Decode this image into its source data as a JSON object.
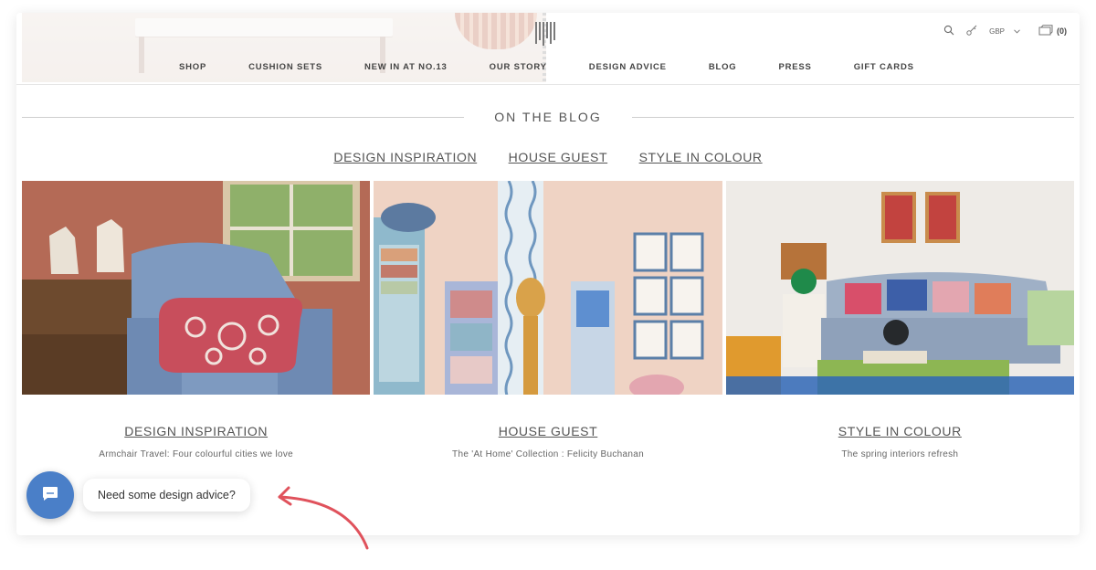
{
  "nav": {
    "items": [
      "SHOP",
      "CUSHION SETS",
      "NEW IN AT NO.13",
      "OUR STORY",
      "DESIGN ADVICE",
      "BLOG",
      "PRESS",
      "GIFT CARDS"
    ]
  },
  "utils": {
    "currency": "GBP",
    "cart_count": "(0)"
  },
  "section": {
    "title": "ON THE BLOG"
  },
  "tabs": [
    "DESIGN INSPIRATION",
    "HOUSE GUEST",
    "STYLE IN COLOUR"
  ],
  "posts": [
    {
      "category": "DESIGN INSPIRATION",
      "title": "Armchair Travel: Four colourful cities we love"
    },
    {
      "category": "HOUSE GUEST",
      "title": "The 'At Home' Collection : Felicity Buchanan"
    },
    {
      "category": "STYLE IN COLOUR",
      "title": "The spring interiors refresh"
    }
  ],
  "chat": {
    "prompt": "Need some design advice?"
  },
  "colors": {
    "chat_button": "#4a7fc8",
    "arrow": "#e0525c"
  }
}
